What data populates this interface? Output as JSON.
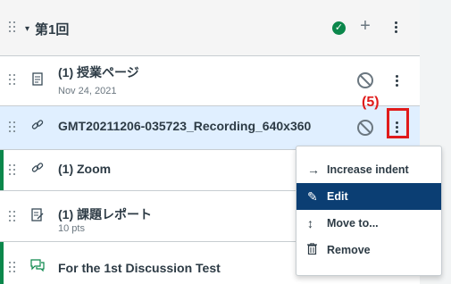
{
  "module": {
    "title": "第1回",
    "caret": "▾",
    "status_icon": "published-check-icon",
    "add_icon": "plus-icon",
    "menu_icon": "kebab-icon"
  },
  "items": [
    {
      "title": "(1) 授業ページ",
      "sub": "Nov 24, 2021",
      "type_icon": "page-icon",
      "published": false
    },
    {
      "title": "GMT20211206-035723_Recording_640x360",
      "sub": "",
      "type_icon": "link-icon",
      "published": false,
      "selected": true
    },
    {
      "title": "(1) Zoom",
      "sub": "",
      "type_icon": "link-icon"
    },
    {
      "title": "(1) 課題レポート",
      "sub": "10 pts",
      "type_icon": "assignment-icon"
    },
    {
      "title": "For the 1st Discussion Test",
      "sub": "",
      "type_icon": "discussion-icon"
    }
  ],
  "annotation": {
    "label": "(5)",
    "color": "#e01b1b"
  },
  "menu": {
    "items": [
      {
        "label": "Increase indent",
        "icon": "arrow-right-icon"
      },
      {
        "label": "Edit",
        "icon": "pencil-icon",
        "active": true
      },
      {
        "label": "Move to...",
        "icon": "updown-arrow-icon"
      },
      {
        "label": "Remove",
        "icon": "trash-icon"
      }
    ]
  },
  "colors": {
    "accent": "#0b3e73",
    "published": "#0b874b",
    "selected_row": "#e0efff"
  }
}
